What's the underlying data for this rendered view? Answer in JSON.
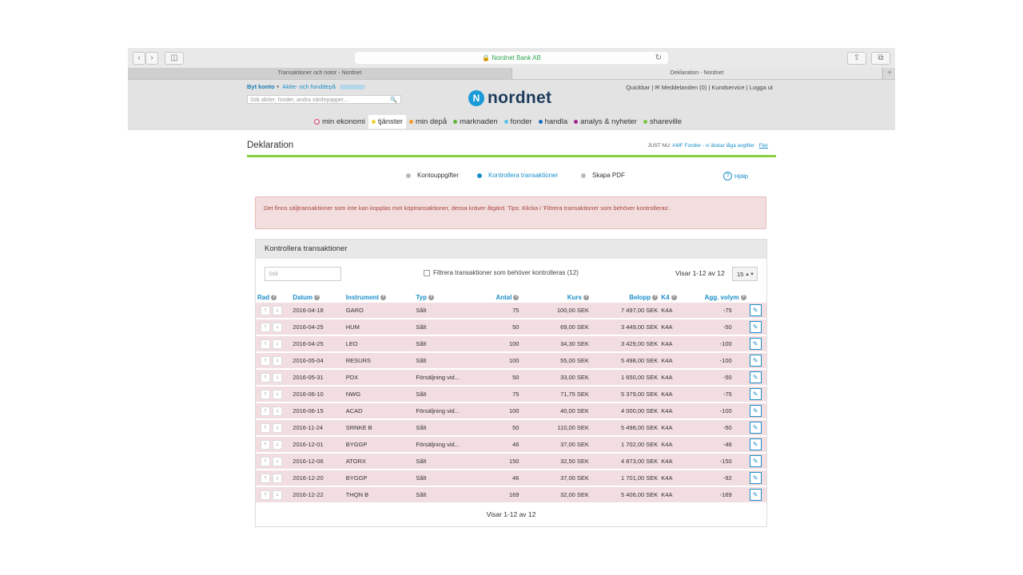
{
  "browser": {
    "address": "Nordnet Bank AB",
    "tabs": [
      "Transaktioner och notor - Nordnet",
      "Deklaration - Nordnet"
    ],
    "tab_add": "+"
  },
  "header": {
    "byt_konto": "Byt konto",
    "account_label": "Aktie- och fonddepå",
    "search_placeholder": "Sök aktier, fonder, andra värdepapper...",
    "logo_text": "nordnet",
    "top_links": "Quickbar | ✉ Meddelanden (0) | Kundservice | Logga ut"
  },
  "nav": [
    {
      "label": "min ekonomi",
      "color": "#e0417d",
      "ring": true
    },
    {
      "label": "tjänster",
      "color": "#f2d23a",
      "active": true
    },
    {
      "label": "min depå",
      "color": "#f39a2b"
    },
    {
      "label": "marknaden",
      "color": "#5bb53a"
    },
    {
      "label": "fonder",
      "color": "#5bc4e6"
    },
    {
      "label": "handla",
      "color": "#1a6fc0"
    },
    {
      "label": "analys & nyheter",
      "color": "#a3268f"
    },
    {
      "label": "shareville",
      "color": "#7dc242"
    }
  ],
  "page": {
    "title": "Deklaration",
    "just_nu_prefix": "JUST NU:",
    "just_nu_link": "AMF Fonder - vi älskar låga avgifter",
    "just_nu_more": "Fler",
    "steps": [
      {
        "label": "Kontouppgifter",
        "color": "#bbbbbb"
      },
      {
        "label": "Kontrollera transaktioner",
        "color": "#1a8ec9"
      },
      {
        "label": "Skapa PDF",
        "color": "#bbbbbb"
      }
    ],
    "help": "Hjälp",
    "alert": "Det finns säljtransaktioner som inte kan kopplas mot köptransaktioner, dessa kräver åtgärd. Tips: Klicka i 'Filtrera transaktioner som behöver kontrolleras'."
  },
  "panel": {
    "title": "Kontrollera transaktioner",
    "search_placeholder": "Sök",
    "filter_label": "Filtrera transaktioner som behöver kontrolleras (12)",
    "visar": "Visar 1-12 av 12",
    "per_page": "15",
    "footer": "Visar 1-12 av 12",
    "columns": [
      "Rad",
      "Datum",
      "Instrument",
      "Typ",
      "Antal",
      "Kurs",
      "Belopp",
      "K4",
      "Agg. volym"
    ],
    "rows": [
      {
        "datum": "2016-04-18",
        "instrument": "GARO",
        "typ": "Sålt",
        "antal": "75",
        "kurs": "100,00 SEK",
        "belopp": "7 497,00 SEK",
        "k4": "K4A",
        "agg": "-75"
      },
      {
        "datum": "2016-04-25",
        "instrument": "HUM",
        "typ": "Sålt",
        "antal": "50",
        "kurs": "69,00 SEK",
        "belopp": "3 449,00 SEK",
        "k4": "K4A",
        "agg": "-50"
      },
      {
        "datum": "2016-04-25",
        "instrument": "LEO",
        "typ": "Sålt",
        "antal": "100",
        "kurs": "34,30 SEK",
        "belopp": "3 429,00 SEK",
        "k4": "K4A",
        "agg": "-100"
      },
      {
        "datum": "2016-05-04",
        "instrument": "RESURS",
        "typ": "Sålt",
        "antal": "100",
        "kurs": "55,00 SEK",
        "belopp": "5 498,00 SEK",
        "k4": "K4A",
        "agg": "-100"
      },
      {
        "datum": "2016-05-31",
        "instrument": "PDX",
        "typ": "Försäljning vid...",
        "antal": "50",
        "kurs": "33,00 SEK",
        "belopp": "1 650,00 SEK",
        "k4": "K4A",
        "agg": "-50"
      },
      {
        "datum": "2016-06-10",
        "instrument": "NWG",
        "typ": "Sålt",
        "antal": "75",
        "kurs": "71,75 SEK",
        "belopp": "5 379,00 SEK",
        "k4": "K4A",
        "agg": "-75"
      },
      {
        "datum": "2016-06-15",
        "instrument": "ACAD",
        "typ": "Försäljning vid...",
        "antal": "100",
        "kurs": "40,00 SEK",
        "belopp": "4 000,00 SEK",
        "k4": "K4A",
        "agg": "-100"
      },
      {
        "datum": "2016-11-24",
        "instrument": "SRNKE B",
        "typ": "Sålt",
        "antal": "50",
        "kurs": "110,00 SEK",
        "belopp": "5 498,00 SEK",
        "k4": "K4A",
        "agg": "-50"
      },
      {
        "datum": "2016-12-01",
        "instrument": "BYGGP",
        "typ": "Försäljning vid...",
        "antal": "46",
        "kurs": "37,00 SEK",
        "belopp": "1 702,00 SEK",
        "k4": "K4A",
        "agg": "-46"
      },
      {
        "datum": "2016-12-06",
        "instrument": "ATORX",
        "typ": "Sålt",
        "antal": "150",
        "kurs": "32,50 SEK",
        "belopp": "4 873,00 SEK",
        "k4": "K4A",
        "agg": "-150"
      },
      {
        "datum": "2016-12-20",
        "instrument": "BYGGP",
        "typ": "Sålt",
        "antal": "46",
        "kurs": "37,00 SEK",
        "belopp": "1 701,00 SEK",
        "k4": "K4A",
        "agg": "-92"
      },
      {
        "datum": "2016-12-22",
        "instrument": "THQN B",
        "typ": "Sålt",
        "antal": "169",
        "kurs": "32,00 SEK",
        "belopp": "5 406,00 SEK",
        "k4": "K4A",
        "agg": "-169"
      }
    ]
  }
}
